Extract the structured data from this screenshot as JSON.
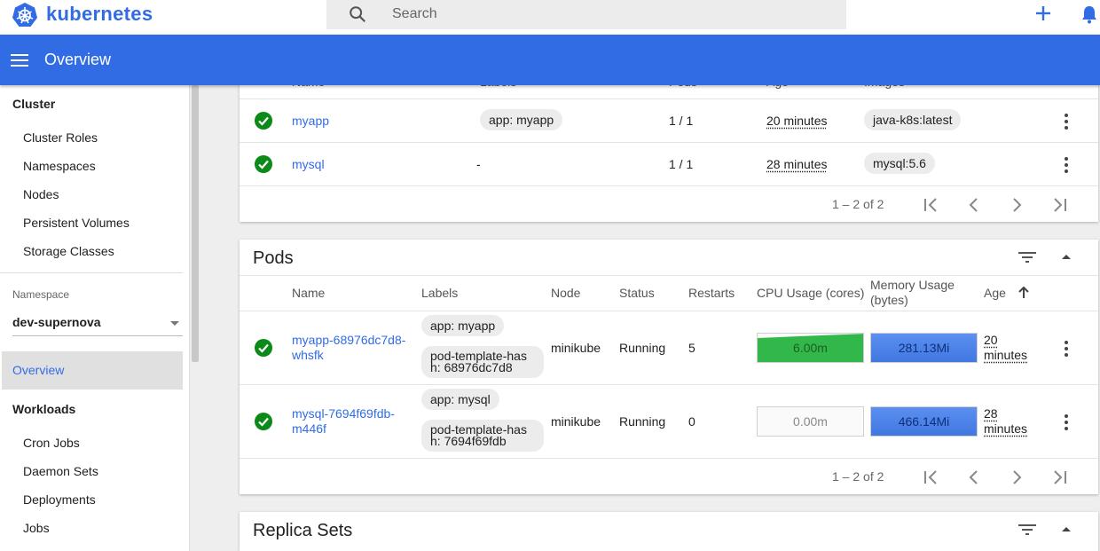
{
  "app": {
    "brand": "kubernetes",
    "page_title": "Overview"
  },
  "search": {
    "placeholder": "Search"
  },
  "icons": {
    "logo": "kubernetes-logo-icon",
    "search": "search-icon",
    "create": "plus-icon",
    "notifications": "bell-icon",
    "menu": "menu-icon",
    "status_ok": "check-circle-icon",
    "more": "more-vert-icon",
    "filter": "filter-icon",
    "collapse": "chevron-up-icon",
    "first": "first-page-icon",
    "prev": "chevron-left-icon",
    "next": "chevron-right-icon",
    "last": "last-page-icon"
  },
  "colors": {
    "accent": "#326ce5",
    "status_ok": "#0b8a1a",
    "cpu_bar": "#32b84a",
    "memory_bar": "#4a82e8"
  },
  "sidebar": {
    "cluster_heading": "Cluster",
    "cluster_items": [
      "Cluster Roles",
      "Namespaces",
      "Nodes",
      "Persistent Volumes",
      "Storage Classes"
    ],
    "namespace_label": "Namespace",
    "namespace_value": "dev-supernova",
    "overview": "Overview",
    "workloads_heading": "Workloads",
    "workload_items": [
      "Cron Jobs",
      "Daemon Sets",
      "Deployments",
      "Jobs"
    ]
  },
  "deployments": {
    "header_partial": [
      "Name",
      "Labels",
      "Pods",
      "Age",
      "Images"
    ],
    "rows": [
      {
        "name": "myapp",
        "label": "app: myapp",
        "pods": "1 / 1",
        "age": "20 minutes",
        "image": "java-k8s:latest"
      },
      {
        "name": "mysql",
        "label": "-",
        "pods": "1 / 1",
        "age": "28 minutes",
        "image": "mysql:5.6"
      }
    ],
    "pagination": "1 – 2 of 2"
  },
  "pods": {
    "title": "Pods",
    "headers": {
      "name": "Name",
      "labels": "Labels",
      "node": "Node",
      "status": "Status",
      "restarts": "Restarts",
      "cpu": "CPU Usage (cores)",
      "memory_1": "Memory Usage",
      "memory_2": "(bytes)",
      "age": "Age"
    },
    "rows": [
      {
        "name_1": "myapp-68976dc7d8-",
        "name_2": "whsfk",
        "label_1": "app: myapp",
        "label_2": "pod-template-hash: 68976dc7d8",
        "node": "minikube",
        "status": "Running",
        "restarts": "5",
        "cpu": "6.00m",
        "cpu_fill": 1.0,
        "memory": "281.13Mi",
        "memory_fill": 1.0,
        "age_1": "20",
        "age_2": "minutes"
      },
      {
        "name_1": "mysql-7694f69fdb-",
        "name_2": "m446f",
        "label_1": "app: mysql",
        "label_2": "pod-template-hash: 7694f69fdb",
        "node": "minikube",
        "status": "Running",
        "restarts": "0",
        "cpu": "0.00m",
        "cpu_fill": 0.0,
        "memory": "466.14Mi",
        "memory_fill": 1.0,
        "age_1": "28",
        "age_2": "minutes"
      }
    ],
    "pagination": "1 – 2 of 2"
  },
  "replica_sets": {
    "title": "Replica Sets"
  }
}
